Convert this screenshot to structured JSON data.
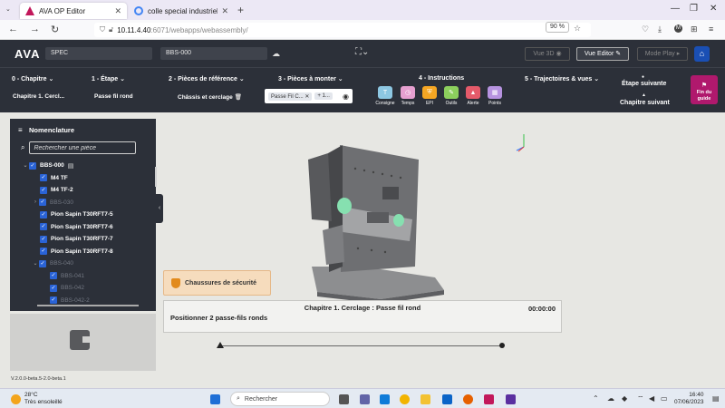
{
  "browser": {
    "tabs": [
      {
        "title": "AVA OP Editor",
        "active": true
      },
      {
        "title": "colle special industriel – Rech",
        "active": false
      }
    ],
    "url_host": "10.11.4.40",
    "url_path": ":6071/webapps/webassembly/",
    "zoom": "90 %"
  },
  "app": {
    "logo": "AVA",
    "project": "SPEC",
    "assembly": "BBS-000",
    "view_3d_label": "Vue 3D",
    "view_editor_label": "Vue Editor",
    "mode_play_label": "Mode Play"
  },
  "steps": {
    "chapter": {
      "header": "0 - Chapitre",
      "value": "Chapitre 1. Cercl..."
    },
    "etape": {
      "header": "1 - Étape",
      "value": "Passe fil rond"
    },
    "ref_parts": {
      "header": "2 - Pièces de référence",
      "value": "Châssis et cerclage"
    },
    "parts_to_mount": {
      "header": "3 - Pièces à monter",
      "chips": [
        "Passe Fil C...",
        "+ 1..."
      ]
    },
    "instructions": {
      "header": "4 - Instructions",
      "items": [
        {
          "label": "Consigne",
          "color": "#8dc7e2",
          "glyph": "T"
        },
        {
          "label": "Temps",
          "color": "#e6a0d0",
          "glyph": "◷"
        },
        {
          "label": "EPI",
          "color": "#f5a623",
          "glyph": "⛨"
        },
        {
          "label": "Outils",
          "color": "#8ccf5d",
          "glyph": "✎"
        },
        {
          "label": "Alerte",
          "color": "#e55a6a",
          "glyph": "▲"
        },
        {
          "label": "Points",
          "color": "#b793e0",
          "glyph": "▦"
        }
      ]
    },
    "trajectories": {
      "header": "5 - Trajectoires & vues"
    },
    "next_step": "Étape suivante",
    "next_chapter": "Chapitre suivant",
    "finish": [
      "Fin du",
      "guide"
    ]
  },
  "nomenclature": {
    "title": "Nomenclature",
    "search_placeholder": "Rechercher une pièce",
    "items": [
      {
        "label": "BBS-000",
        "chevron": "⌄",
        "doc": true,
        "muted": false,
        "indent": 0
      },
      {
        "label": "M4 TF",
        "chevron": "",
        "doc": false,
        "muted": false,
        "indent": 1
      },
      {
        "label": "M4 TF-2",
        "chevron": "",
        "doc": false,
        "muted": false,
        "indent": 1
      },
      {
        "label": "BBS-030",
        "chevron": "›",
        "doc": false,
        "muted": true,
        "indent": 1
      },
      {
        "label": "Pion Sapin T30RFT7-5",
        "chevron": "",
        "doc": false,
        "muted": false,
        "indent": 1
      },
      {
        "label": "Pion Sapin T30RFT7-6",
        "chevron": "",
        "doc": false,
        "muted": false,
        "indent": 1
      },
      {
        "label": "Pion Sapin T30RFT7-7",
        "chevron": "",
        "doc": false,
        "muted": false,
        "indent": 1
      },
      {
        "label": "Pion Sapin T30RFT7-8",
        "chevron": "",
        "doc": false,
        "muted": false,
        "indent": 1
      },
      {
        "label": "BBS-040",
        "chevron": "⌄",
        "doc": false,
        "muted": true,
        "indent": 1
      },
      {
        "label": "BBS-041",
        "chevron": "",
        "doc": false,
        "muted": true,
        "indent": 2
      },
      {
        "label": "BBS-042",
        "chevron": "",
        "doc": false,
        "muted": true,
        "indent": 2
      },
      {
        "label": "BBS-042-2",
        "chevron": "",
        "doc": false,
        "muted": true,
        "indent": 2
      }
    ]
  },
  "safety": {
    "label": "Chaussures de sécurité"
  },
  "step_panel": {
    "title": "Chapitre 1. Cerclage : Passe fil rond",
    "time": "00:00:00",
    "description": "Positionner 2 passe-fils ronds"
  },
  "version": "V.2.0.0-beta.5-2.0-beta.1",
  "taskbar": {
    "temperature": "28°C",
    "weather": "Très ensoleillé",
    "search": "Rechercher",
    "time": "16:40",
    "date": "07/06/2023"
  }
}
